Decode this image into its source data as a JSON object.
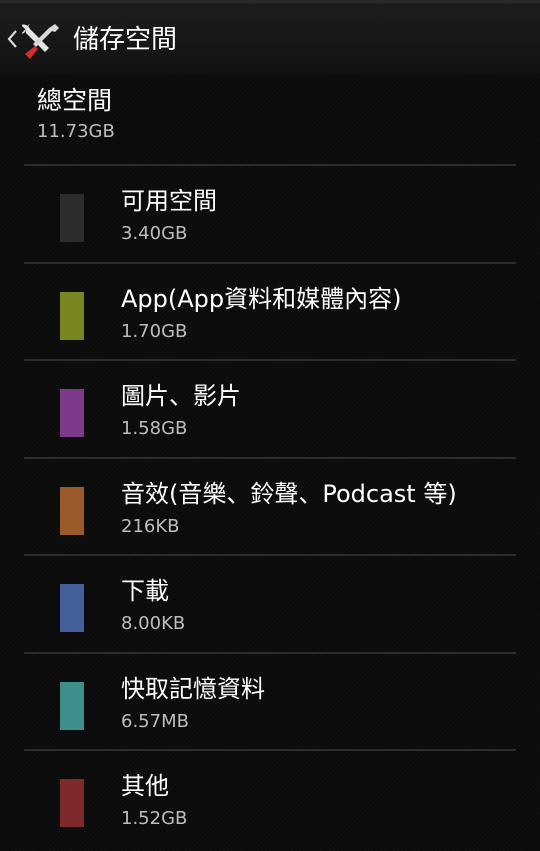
{
  "header": {
    "back_icon": "chevron-left-icon",
    "app_icon": "settings-tools-icon",
    "title": "儲存空間"
  },
  "total": {
    "label": "總空間",
    "value": "11.73GB"
  },
  "items": [
    {
      "label": "可用空間",
      "value": "3.40GB",
      "color": "#2d2d2d"
    },
    {
      "label": "App(App資料和媒體內容)",
      "value": "1.70GB",
      "color": "#7a8622"
    },
    {
      "label": "圖片、影片",
      "value": "1.58GB",
      "color": "#7d3a8a"
    },
    {
      "label": "音效(音樂、鈴聲、Podcast 等)",
      "value": "216KB",
      "color": "#9b5a2a"
    },
    {
      "label": "下載",
      "value": "8.00KB",
      "color": "#43609c"
    },
    {
      "label": "快取記憶資料",
      "value": "6.57MB",
      "color": "#3d8f8b"
    },
    {
      "label": "其他",
      "value": "1.52GB",
      "color": "#7e2a2c"
    }
  ]
}
